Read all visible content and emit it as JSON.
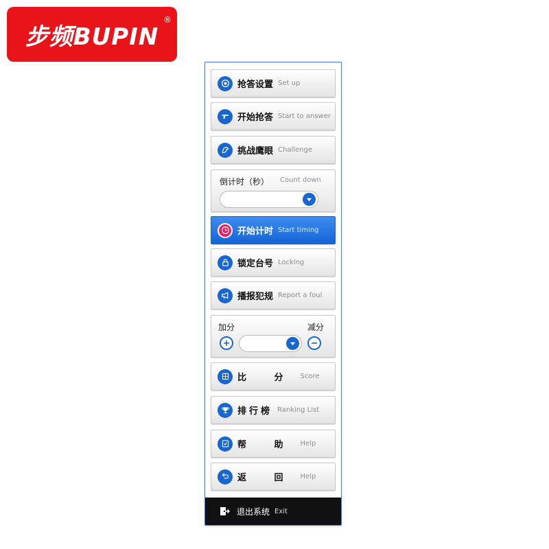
{
  "brand": {
    "logo_text": "步频BUPIN",
    "registered_mark": "®",
    "color": "#e8141a"
  },
  "menu": {
    "accent_color": "#1866d0",
    "items": [
      {
        "id": "setup",
        "zh": "抢答设置",
        "en": "Set up",
        "icon": "target-icon"
      },
      {
        "id": "start-answer",
        "zh": "开始抢答",
        "en": "Start to answer",
        "icon": "buzzer-gun-icon"
      },
      {
        "id": "challenge",
        "zh": "挑战鹰眼",
        "en": "Challenge",
        "icon": "eagle-icon"
      },
      {
        "id": "start-timing",
        "zh": "开始计时",
        "en": "Start timing",
        "icon": "clock-icon",
        "active": true
      },
      {
        "id": "locking",
        "zh": "锁定台号",
        "en": "Locking",
        "icon": "lock-icon"
      },
      {
        "id": "report-foul",
        "zh": "播报犯规",
        "en": "Report a foul",
        "icon": "megaphone-icon"
      },
      {
        "id": "score",
        "zh": "比 分",
        "en": "Score",
        "icon": "scoreboard-icon"
      },
      {
        "id": "ranking",
        "zh": "排行榜",
        "en": "Ranking List",
        "icon": "trophy-icon"
      },
      {
        "id": "help",
        "zh": "帮 助",
        "en": "Help",
        "icon": "checklist-icon"
      },
      {
        "id": "back",
        "zh": "返 回",
        "en": "Help",
        "icon": "return-icon"
      }
    ]
  },
  "countdown": {
    "label": "倒计时（秒）",
    "label_en": "Count down",
    "value": ""
  },
  "score_adjust": {
    "add_label": "加分",
    "subtract_label": "减分",
    "value": ""
  },
  "exit": {
    "zh": "退出系统",
    "en": "Exit",
    "icon": "exit-door-icon"
  }
}
